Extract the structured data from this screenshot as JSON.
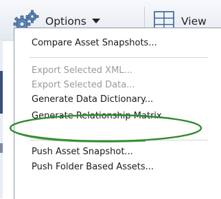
{
  "toolbar": {
    "options_label": "Options",
    "view_label": "View",
    "options_icon": "gear-icon",
    "view_icon": "grid-layout-icon"
  },
  "menu": {
    "items": [
      {
        "label": "Compare Asset Snapshots...",
        "enabled": true
      },
      {
        "label": "Export Selected XML...",
        "enabled": false
      },
      {
        "label": "Export Selected Data...",
        "enabled": false
      },
      {
        "label": "Generate Data Dictionary...",
        "enabled": true
      },
      {
        "label": "Generate Relationship Matrix...",
        "enabled": true,
        "highlighted": true
      },
      {
        "label": "Push Asset Snapshot...",
        "enabled": true
      },
      {
        "label": "Push Folder Based Assets...",
        "enabled": true
      }
    ]
  },
  "colors": {
    "highlight_ring": "#2e8b2e",
    "disabled_text": "#9a9a9a",
    "toolbar_gradient_top": "#f7f9fc",
    "toolbar_gradient_bottom": "#e4e9f1"
  }
}
